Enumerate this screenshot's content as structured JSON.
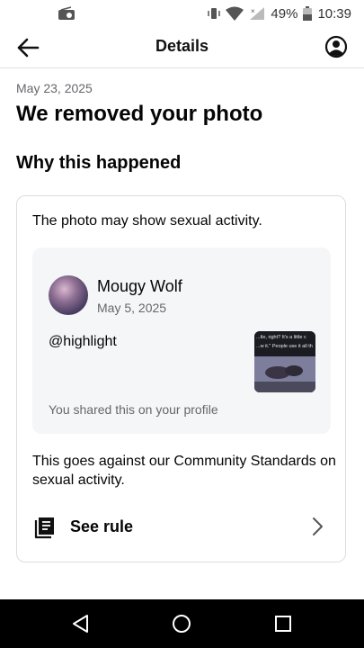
{
  "status_bar": {
    "battery": "49%",
    "time": "10:39"
  },
  "app_bar": {
    "title": "Details"
  },
  "notice": {
    "date": "May 23, 2025",
    "heading": "We removed your photo",
    "subheading": "Why this happened"
  },
  "card": {
    "reason": "The photo may show sexual activity.",
    "post": {
      "author": "Mougy Wolf",
      "date": "May 5, 2025",
      "text": "@highlight",
      "shared_note": "You shared this on your profile",
      "thumbnail_caption_1": "...tle, right? It's a little c",
      "thumbnail_caption_2": "...w it.\" People use it all th"
    },
    "violation": "This goes against our Community Standards on sexual activity.",
    "see_rule_label": "See rule"
  },
  "icons": {
    "back": "arrow-left-icon",
    "account": "account-circle-icon",
    "rule": "book-icon",
    "chevron": "chevron-right-icon",
    "nav_back": "triangle-back-icon",
    "nav_home": "circle-home-icon",
    "nav_recents": "square-recents-icon"
  }
}
